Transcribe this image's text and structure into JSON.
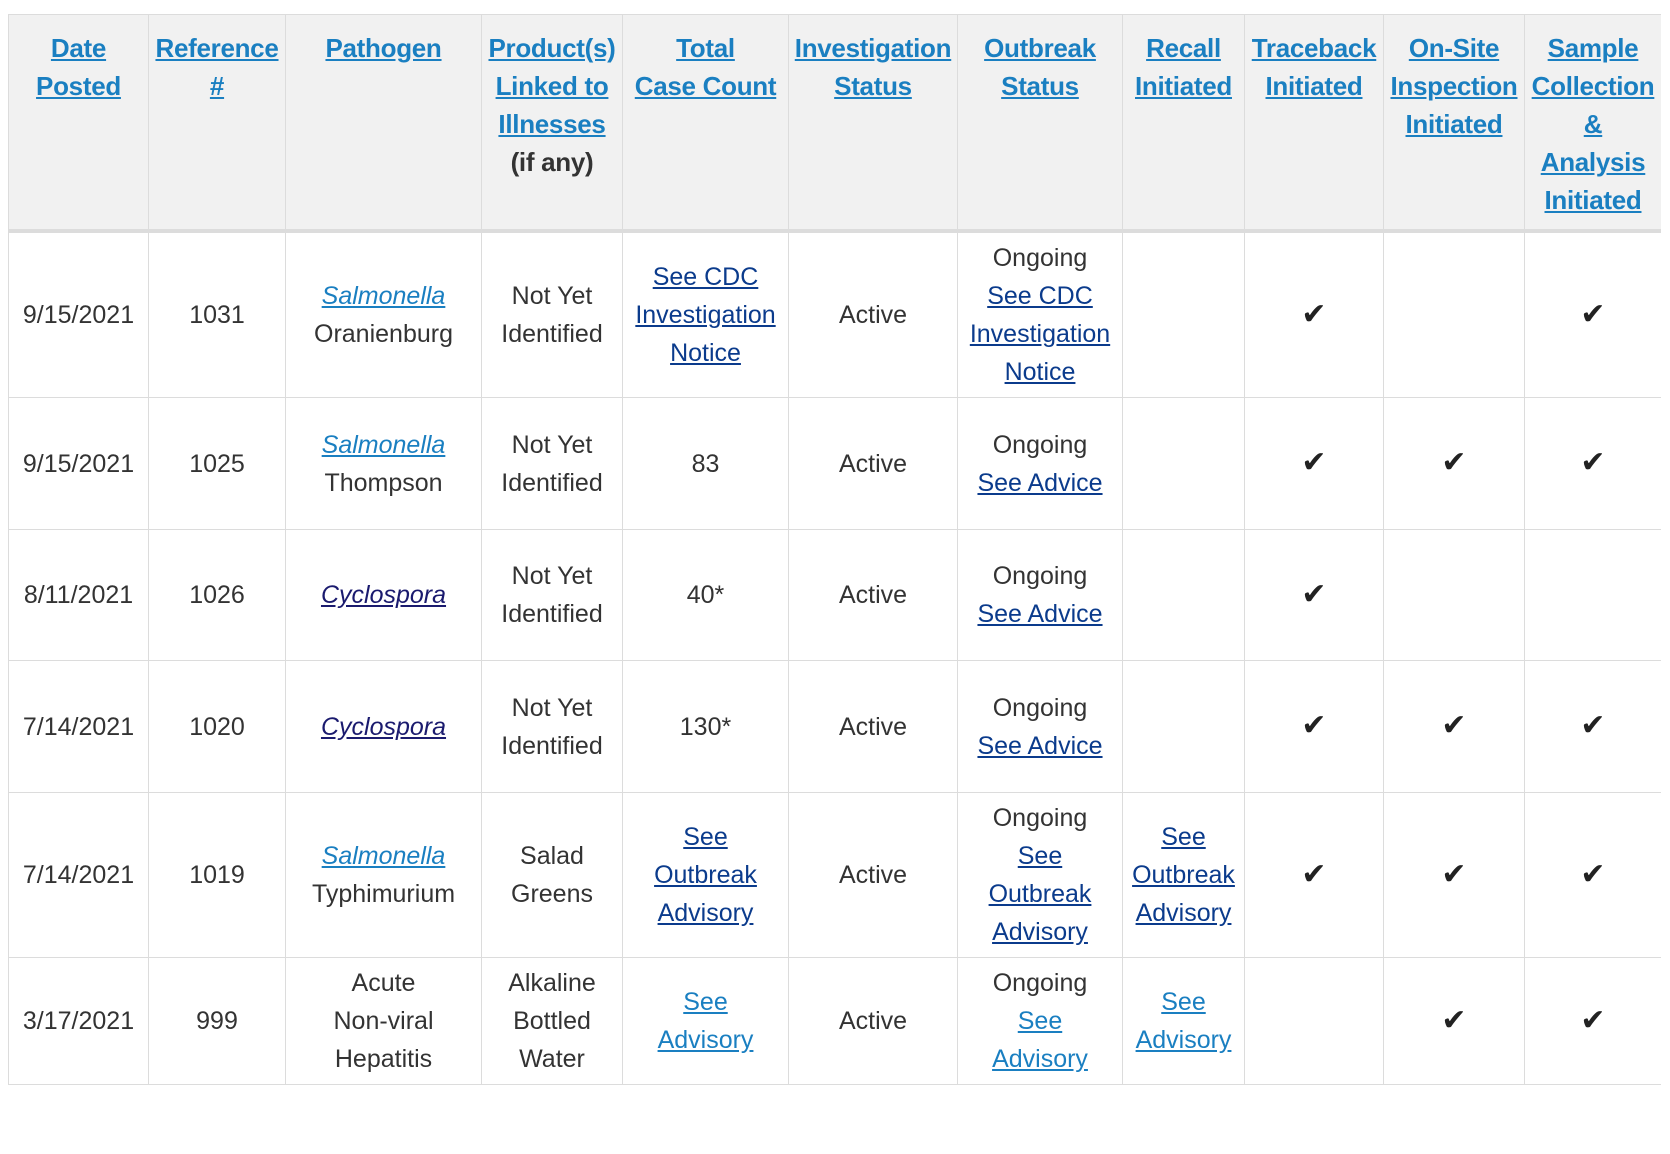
{
  "headers": [
    {
      "lines": [
        "Date",
        "Posted"
      ],
      "extra": ""
    },
    {
      "lines": [
        "Reference",
        "#"
      ],
      "extra": ""
    },
    {
      "lines": [
        "Pathogen"
      ],
      "extra": ""
    },
    {
      "lines": [
        "Product(s)",
        "Linked to",
        "Illnesses"
      ],
      "extra": "(if any)"
    },
    {
      "lines": [
        "Total",
        "Case Count"
      ],
      "extra": ""
    },
    {
      "lines": [
        "Investigation",
        "Status"
      ],
      "extra": ""
    },
    {
      "lines": [
        "Outbreak",
        "Status"
      ],
      "extra": ""
    },
    {
      "lines": [
        "Recall",
        "Initiated"
      ],
      "extra": ""
    },
    {
      "lines": [
        "Traceback",
        "Initiated"
      ],
      "extra": ""
    },
    {
      "lines": [
        "On-Site",
        "Inspection",
        "Initiated"
      ],
      "extra": ""
    },
    {
      "lines": [
        "Sample",
        "Collection",
        "&",
        "Analysis",
        "Initiated"
      ],
      "extra": ""
    }
  ],
  "check_mark": "✔",
  "rows": [
    {
      "date": "9/15/2021",
      "ref": "1031",
      "pathogen_link": "Salmonella",
      "pathogen_rest": [
        "Oranienburg"
      ],
      "pathogen_style": "italic-link",
      "product": [
        "Not Yet",
        "Identified"
      ],
      "case_count": {
        "type": "link",
        "lines": [
          "See CDC",
          "Investigation",
          "Notice"
        ]
      },
      "investigation": "Active",
      "outbreak_status": "Ongoing",
      "outbreak_link": [
        "See CDC",
        "Investigation",
        "Notice"
      ],
      "recall": [],
      "traceback": true,
      "onsite": false,
      "sample": true,
      "height": 165
    },
    {
      "date": "9/15/2021",
      "ref": "1025",
      "pathogen_link": "Salmonella",
      "pathogen_rest": [
        "Thompson"
      ],
      "pathogen_style": "italic-link",
      "product": [
        "Not Yet",
        "Identified"
      ],
      "case_count": {
        "type": "text",
        "lines": [
          "83"
        ]
      },
      "investigation": "Active",
      "outbreak_status": "Ongoing",
      "outbreak_link": [
        "See Advice"
      ],
      "recall": [],
      "traceback": true,
      "onsite": true,
      "sample": true,
      "height": 132
    },
    {
      "date": "8/11/2021",
      "ref": "1026",
      "pathogen_link": "Cyclospora",
      "pathogen_rest": [],
      "pathogen_style": "italic-dark",
      "product": [
        "Not Yet",
        "Identified"
      ],
      "case_count": {
        "type": "text",
        "lines": [
          "40*"
        ]
      },
      "investigation": "Active",
      "outbreak_status": "Ongoing",
      "outbreak_link": [
        "See Advice"
      ],
      "recall": [],
      "traceback": true,
      "onsite": false,
      "sample": false,
      "height": 131
    },
    {
      "date": "7/14/2021",
      "ref": "1020",
      "pathogen_link": "Cyclospora",
      "pathogen_rest": [],
      "pathogen_style": "italic-dark",
      "product": [
        "Not Yet",
        "Identified"
      ],
      "case_count": {
        "type": "text",
        "lines": [
          "130*"
        ]
      },
      "investigation": "Active",
      "outbreak_status": "Ongoing",
      "outbreak_link": [
        "See Advice"
      ],
      "recall": [],
      "traceback": true,
      "onsite": true,
      "sample": true,
      "height": 132
    },
    {
      "date": "7/14/2021",
      "ref": "1019",
      "pathogen_link": "Salmonella",
      "pathogen_rest": [
        "Typhimurium"
      ],
      "pathogen_style": "italic-link",
      "product": [
        "Salad",
        "Greens"
      ],
      "case_count": {
        "type": "link",
        "lines": [
          "See",
          "Outbreak",
          "Advisory"
        ]
      },
      "investigation": "Active",
      "outbreak_status": "Ongoing",
      "outbreak_link": [
        "See",
        "Outbreak",
        "Advisory"
      ],
      "recall": [
        "See",
        "Outbreak",
        "Advisory"
      ],
      "traceback": true,
      "onsite": true,
      "sample": true,
      "height": 163
    },
    {
      "date": "3/17/2021",
      "ref": "999",
      "pathogen_link": "",
      "pathogen_rest": [
        "Acute",
        "Non-viral",
        "Hepatitis"
      ],
      "pathogen_style": "plain",
      "product": [
        "Alkaline",
        "Bottled",
        "Water"
      ],
      "case_count": {
        "type": "link-light",
        "lines": [
          "See",
          "Advisory"
        ]
      },
      "investigation": "Active",
      "outbreak_status": "Ongoing",
      "outbreak_link": [
        "See",
        "Advisory"
      ],
      "recall": [
        "See",
        "Advisory"
      ],
      "traceback": false,
      "onsite": true,
      "sample": true,
      "height": 127
    }
  ]
}
